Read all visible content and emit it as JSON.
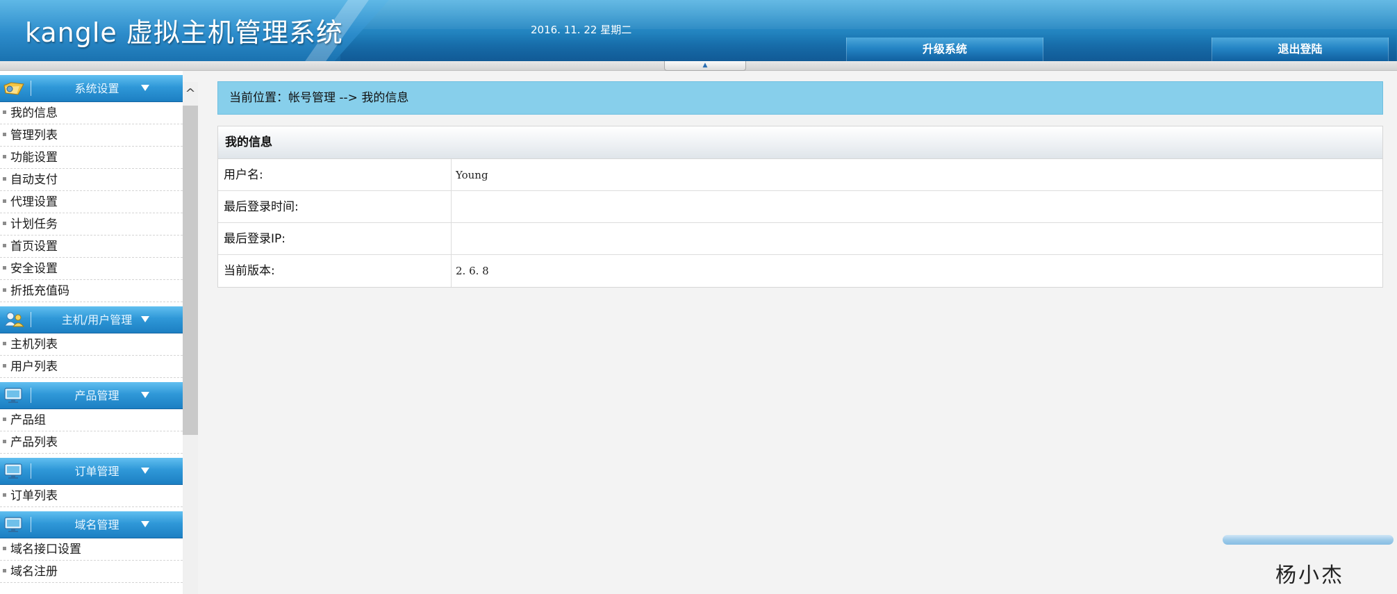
{
  "header": {
    "title": "kangle 虚拟主机管理系统",
    "date": "2016. 11. 22  星期二",
    "upgrade_label": "升级系统",
    "logout_label": "退出登陆",
    "collapse_glyph": "▲"
  },
  "sidebar": {
    "groups": [
      {
        "title": "系统设置",
        "icon": "folder-gear-icon",
        "items": [
          "我的信息",
          "管理列表",
          "功能设置",
          "自动支付",
          "代理设置",
          "计划任务",
          "首页设置",
          "安全设置",
          "折抵充值码"
        ]
      },
      {
        "title": "主机/用户管理",
        "icon": "users-icon",
        "items": [
          "主机列表",
          "用户列表"
        ]
      },
      {
        "title": "产品管理",
        "icon": "monitor-icon",
        "items": [
          "产品组",
          "产品列表"
        ]
      },
      {
        "title": "订单管理",
        "icon": "monitor-icon",
        "items": [
          "订单列表"
        ]
      },
      {
        "title": "域名管理",
        "icon": "monitor-icon",
        "items": [
          "域名接口设置",
          "域名注册"
        ]
      }
    ],
    "scroll_up_glyph": "^"
  },
  "main": {
    "breadcrumb": "当前位置：帐号管理 --> 我的信息",
    "table": {
      "title": "我的信息",
      "rows": [
        {
          "label": "用户名:",
          "value": "Young"
        },
        {
          "label": "最后登录时间:",
          "value": ""
        },
        {
          "label": "最后登录IP:",
          "value": ""
        },
        {
          "label": "当前版本:",
          "value": "2. 6. 8"
        }
      ]
    }
  },
  "signature": "杨小杰",
  "colors": {
    "header_blue": "#1b78b5",
    "menu_header_blue": "#2f98d8",
    "breadcrumb_bg": "#87cfeb"
  }
}
